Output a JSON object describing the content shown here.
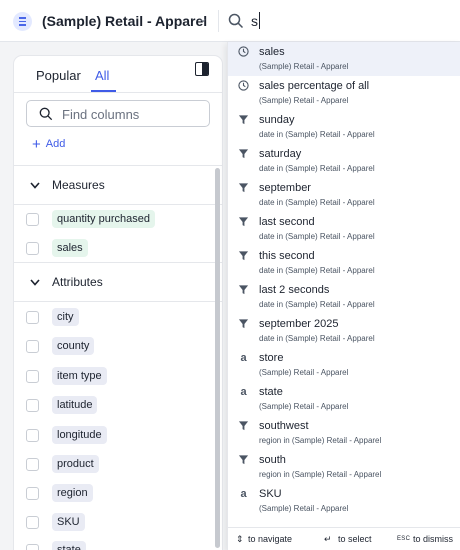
{
  "topbar": {
    "datasource": "(Sample) Retail - Apparel",
    "search_value": "s",
    "icons": [
      "datasource-icon",
      "chevron-down-icon",
      "search-icon"
    ]
  },
  "panel": {
    "tabs": [
      "Popular",
      "All"
    ],
    "active_tab": "All",
    "find_placeholder": "Find columns",
    "add_label": "Add",
    "measures_label": "Measures",
    "measures": [
      "quantity purchased",
      "sales"
    ],
    "attributes_label": "Attributes",
    "attributes": [
      "city",
      "county",
      "item type",
      "latitude",
      "longitude",
      "product",
      "region",
      "SKU",
      "state"
    ]
  },
  "dropdown": {
    "items": [
      {
        "icon": "clock-icon",
        "title": "sales",
        "subtitle": "(Sample) Retail - Apparel"
      },
      {
        "icon": "clock-icon",
        "title": "sales percentage of all",
        "subtitle": "(Sample) Retail - Apparel"
      },
      {
        "icon": "filter-icon",
        "title": "sunday",
        "subtitle": "date in (Sample) Retail - Apparel"
      },
      {
        "icon": "filter-icon",
        "title": "saturday",
        "subtitle": "date in (Sample) Retail - Apparel"
      },
      {
        "icon": "filter-icon",
        "title": "september",
        "subtitle": "date in (Sample) Retail - Apparel"
      },
      {
        "icon": "filter-icon",
        "title": "last second",
        "subtitle": "date in (Sample) Retail - Apparel"
      },
      {
        "icon": "filter-icon",
        "title": "this second",
        "subtitle": "date in (Sample) Retail - Apparel"
      },
      {
        "icon": "filter-icon",
        "title": "last 2 seconds",
        "subtitle": "date in (Sample) Retail - Apparel"
      },
      {
        "icon": "filter-icon",
        "title": "september 2025",
        "subtitle": "date in (Sample) Retail - Apparel"
      },
      {
        "icon": "attribute-icon",
        "title": "store",
        "subtitle": "(Sample) Retail - Apparel"
      },
      {
        "icon": "attribute-icon",
        "title": "state",
        "subtitle": "(Sample) Retail - Apparel"
      },
      {
        "icon": "filter-icon",
        "title": "southwest",
        "subtitle": "region in (Sample) Retail - Apparel"
      },
      {
        "icon": "filter-icon",
        "title": "south",
        "subtitle": "region in (Sample) Retail - Apparel"
      },
      {
        "icon": "attribute-icon",
        "title": "SKU",
        "subtitle": "(Sample) Retail - Apparel"
      }
    ],
    "attribute_glyph": "a",
    "footer": {
      "navigate_key": "⇕",
      "navigate": "to navigate",
      "select_key": "↵",
      "select": "to select",
      "dismiss_key": "ESC",
      "dismiss": "to dismiss"
    }
  },
  "colors": {
    "accent": "#3f5be7",
    "measure_chip": "#e5f5ec",
    "attribute_chip": "#e9ebf4",
    "selected_row": "#eef1f9"
  }
}
